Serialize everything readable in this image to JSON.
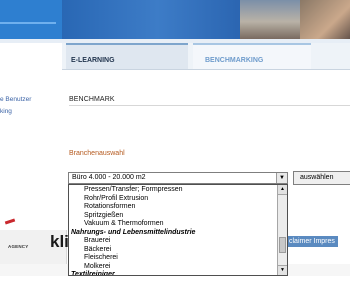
{
  "tabs": {
    "elearning": "E-LEARNING",
    "benchmarking": "BENCHMARKING"
  },
  "sidebar": {
    "link1": "e Benutzer",
    "link2": "king"
  },
  "page": {
    "title": "BENCHMARK",
    "section_label": "Branchenauswahl"
  },
  "select": {
    "value": "Büro 4.000 - 20.000 m2",
    "button_label": "auswählen",
    "options": [
      "Pressen/Transfer; Formpressen",
      "Rohr/Profil Extrusion",
      "Rotationsformen",
      "Spritzgießen",
      "Vakuum & Thermoformen",
      "Nahrungs- und Lebensmittelindustrie",
      "Brauerei",
      "Bäckerei",
      "Fleischerei",
      "Molkerei",
      "Textilreiniger"
    ],
    "group_flags": [
      false,
      false,
      false,
      false,
      false,
      true,
      false,
      false,
      false,
      false,
      true
    ]
  },
  "footer": {
    "logo_text": "kli",
    "agency_text": "AGENCY",
    "links": "claimer Impres"
  },
  "colors": {
    "banner_blue": "#2a64b0",
    "section_orange": "#b55a1f",
    "link_blue": "#3b63a6"
  }
}
